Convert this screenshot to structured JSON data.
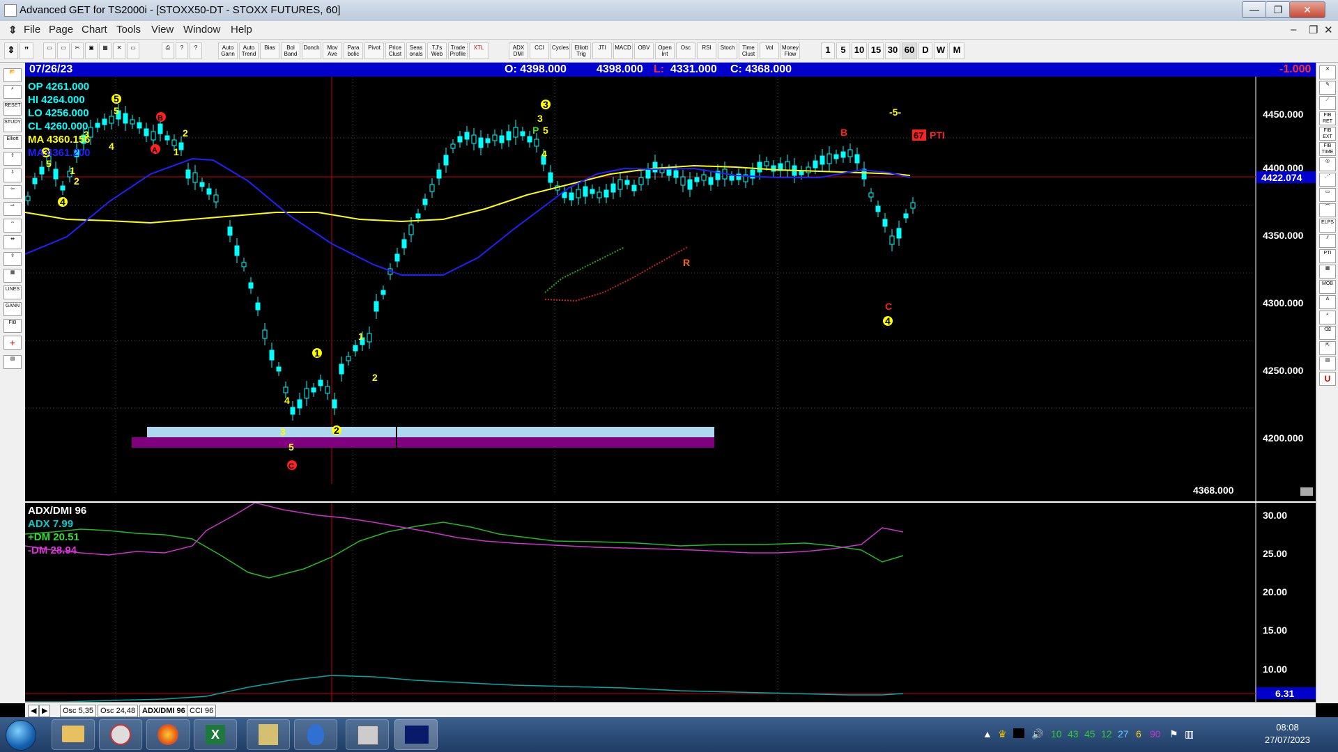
{
  "window": {
    "title": "Advanced GET for TS2000i - [STOXX50-DT - STOXX FUTURES, 60]",
    "minimize": "—",
    "maximize": "❐",
    "close": "✕"
  },
  "menu": [
    "File",
    "Page",
    "Chart",
    "Tools",
    "View",
    "Window",
    "Help"
  ],
  "toolbar": {
    "studies": [
      "Auto Gann",
      "Auto Trend",
      "Bias",
      "Bol Band",
      "Donch",
      "Mov Ave",
      "Para bolic",
      "Pivot",
      "Price Clust",
      "Seas onals",
      "TJ's Web",
      "Trade Profile",
      "XTL"
    ],
    "indicators": [
      "ADX DMI",
      "CCI",
      "Cycles",
      "Elliott Trig",
      "JTI",
      "MACD",
      "OBV",
      "Open Int",
      "Osc",
      "RSI",
      "Stoch",
      "Time Clust",
      "Vol",
      "Money Flow"
    ],
    "intervals": [
      "1",
      "5",
      "10",
      "15",
      "30",
      "60",
      "D",
      "W",
      "M"
    ]
  },
  "infobar": {
    "date": "07/26/23",
    "open": "O: 4398.000",
    "high": "4398.000",
    "low_label": "L:",
    "low": "4331.000",
    "close": "C: 4368.000",
    "change": "-1.000"
  },
  "data_window": {
    "op": "OP  4261.000",
    "hi": "HI   4264.000",
    "lo": "LO  4256.000",
    "cl": "CL  4260.000",
    "ma1": "MA  4360.156",
    "ma2": "MA  4361.200"
  },
  "price_axis": [
    "4450.000",
    "4400.000",
    "4350.000",
    "4300.000",
    "4250.000",
    "4200.000"
  ],
  "current_price": "4422.074",
  "last_price": "4368.000",
  "pti": {
    "value": "67",
    "label": "PTI"
  },
  "wave_labels": {
    "w5_top": "-5-",
    "b_right": "B",
    "c_right": "C",
    "r_mid": "R",
    "p_mark": "P"
  },
  "osc": {
    "title": "ADX/DMI 96",
    "adx": "ADX 7.99",
    "pdm": "+DM 20.51",
    "mdm": "-DM  28.94",
    "axis": [
      "30.00",
      "25.00",
      "20.00",
      "15.00",
      "10.00"
    ],
    "current": "6.31"
  },
  "tabs": [
    "Osc 5,35",
    "Osc 24,48",
    "ADX/DMI 96",
    "CCI 96"
  ],
  "clock": {
    "time": "08:08",
    "date": "27/07/2023"
  },
  "tray_numbers": [
    "10",
    "43",
    "45",
    "12",
    "27",
    "6",
    "90"
  ],
  "colors": {
    "infobar": "#0000cc",
    "ma_yellow": "#ffff00",
    "ma_blue": "#2020ff",
    "candle": "#00ffff",
    "adx": "#00cccc",
    "pdm": "#00cc00",
    "mdm": "#cc33cc",
    "wave_red": "#ff2020",
    "wave_yellow": "#ffff00"
  }
}
